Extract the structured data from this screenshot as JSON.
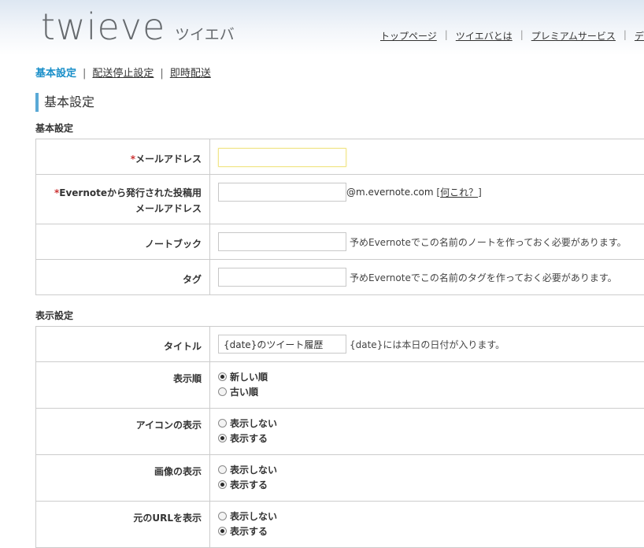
{
  "header": {
    "logo_main": "twieve",
    "logo_sub": "ツイエバ",
    "nav": [
      {
        "label": "トップページ"
      },
      {
        "label": "ツイエバとは"
      },
      {
        "label": "プレミアムサービス"
      },
      {
        "label": "デ"
      }
    ]
  },
  "subnav": {
    "active": "基本設定",
    "items": [
      {
        "label": "配送停止設定"
      },
      {
        "label": "即時配送"
      }
    ],
    "separator": "|"
  },
  "page_title": "基本設定",
  "basic": {
    "section_label": "基本設定",
    "required_mark": "*",
    "email_label": "メールアドレス",
    "email_value": "",
    "evernote_label_line1": "Evernoteから発行された投稿用",
    "evernote_label_line2": "メールアドレス",
    "evernote_value": "",
    "evernote_domain": "@m.evernote.com",
    "help_open": "[",
    "help_link": "何これ？",
    "help_close": "]",
    "notebook_label": "ノートブック",
    "notebook_value": "",
    "notebook_hint": "予めEvernoteでこの名前のノートを作っておく必要があります。",
    "tag_label": "タグ",
    "tag_value": "",
    "tag_hint": "予めEvernoteでこの名前のタグを作っておく必要があります。"
  },
  "display": {
    "section_label": "表示設定",
    "title_label": "タイトル",
    "title_value": "{date}のツイート履歴",
    "title_hint": "{date}には本日の日付が入ります。",
    "order_label": "表示順",
    "order_options": [
      "新しい順",
      "古い順"
    ],
    "order_selected": "新しい順",
    "icon_label": "アイコンの表示",
    "icon_options": [
      "表示しない",
      "表示する"
    ],
    "icon_selected": "表示する",
    "image_label": "画像の表示",
    "image_options": [
      "表示しない",
      "表示する"
    ],
    "image_selected": "表示する",
    "url_label": "元のURLを表示",
    "url_options": [
      "表示しない",
      "表示する"
    ],
    "url_selected": "表示する"
  }
}
